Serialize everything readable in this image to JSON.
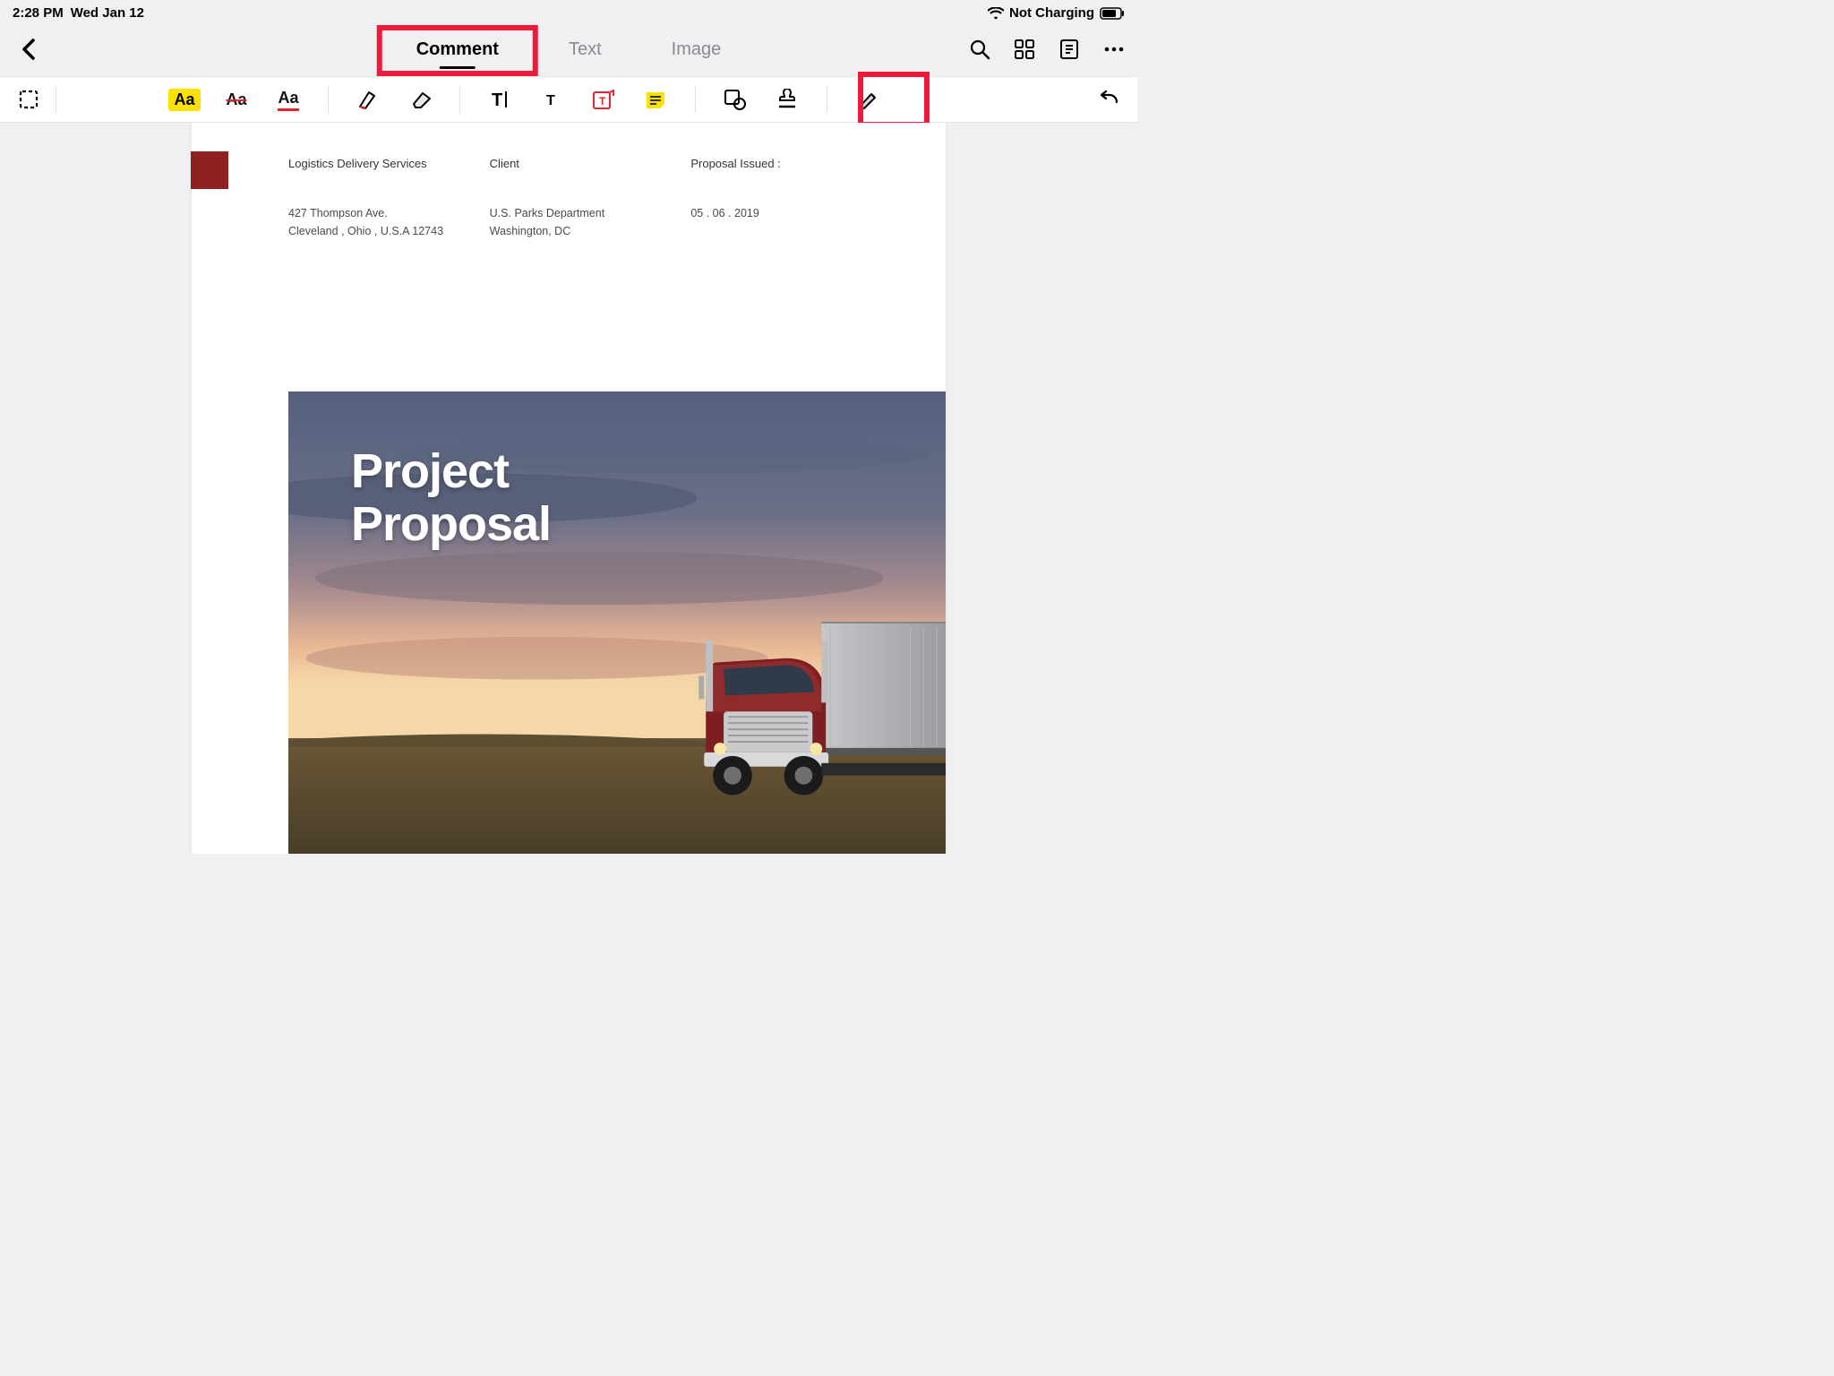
{
  "status": {
    "time": "2:28 PM",
    "date": "Wed Jan 12",
    "charging": "Not Charging"
  },
  "nav": {
    "tabs": {
      "comment": "Comment",
      "text": "Text",
      "image": "Image"
    }
  },
  "document": {
    "company_label": "Logistics Delivery Services",
    "company_addr1": "427 Thompson Ave.",
    "company_addr2": "Cleveland , Ohio , U.S.A 12743",
    "client_label": "Client",
    "client_name": "U.S. Parks Department",
    "client_addr": "Washington, DC",
    "issued_label": "Proposal Issued :",
    "issued_date": "05 . 06 . 2019",
    "hero_title1": "Project",
    "hero_title2": "Proposal"
  }
}
